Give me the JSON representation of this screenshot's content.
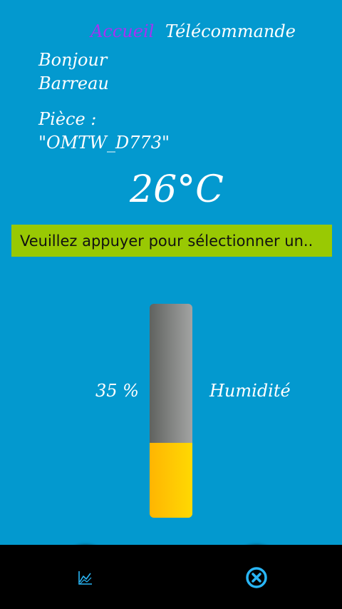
{
  "nav": {
    "home_label": "Accueil",
    "remote_label": "Télécommande"
  },
  "greeting": {
    "line1": "Bonjour",
    "line2": "Barreau"
  },
  "room": {
    "label": "Pièce :",
    "name": "\"OMTW_D773\""
  },
  "temperature": {
    "value": "26°C"
  },
  "selector": {
    "text": "Veuillez appuyer pour sélectionner un.."
  },
  "humidity": {
    "value_text": "35 %",
    "label": "Humidité",
    "level_percent": 35
  },
  "bottom_bar": {
    "left_icon": "chart-icon",
    "right_icon": "close-circle-icon"
  },
  "colors": {
    "background": "#0399cf",
    "accent_purple": "#a533f2",
    "selector_green": "#99c903",
    "gauge_fill": "#ffc703",
    "icon_cyan": "#29b6f6"
  }
}
